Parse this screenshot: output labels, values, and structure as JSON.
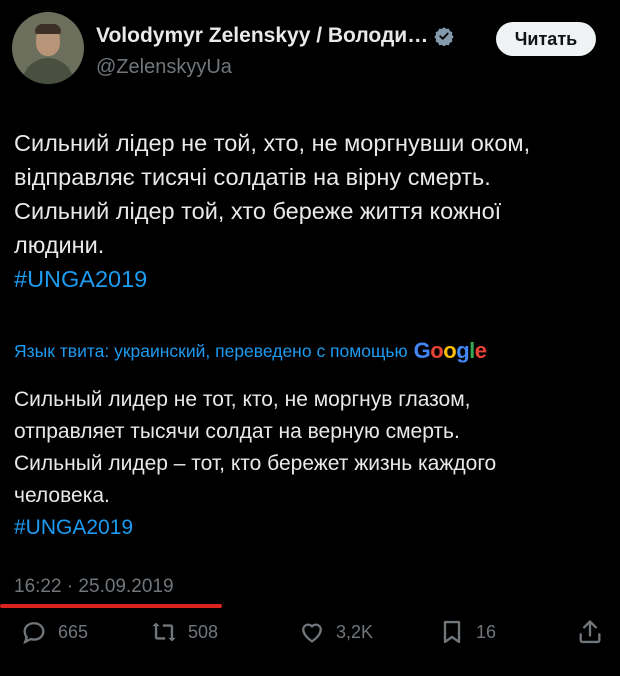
{
  "author": {
    "name": "Volodymyr Zelenskyy / Володи…",
    "handle": "@ZelenskyyUa",
    "follow_label": "Читать"
  },
  "tweet": {
    "lines": [
      "Сильний лідер не той, хто, не моргнувши оком,",
      "відправляє тисячі солдатів на вірну смерть.",
      "Сильний лідер той, хто береже життя кожної",
      "людини."
    ],
    "hashtag": "#UNGA2019"
  },
  "translation": {
    "label": "Язык твита: украинский, переведено с помощью",
    "provider": "Google",
    "lines": [
      "Сильный лидер не тот, кто, не моргнув глазом,",
      "отправляет тысячи солдат на верную смерть.",
      "Сильный лидер – тот, кто бережет жизнь каждого",
      "человека."
    ],
    "hashtag": "#UNGA2019"
  },
  "timestamp": "16:22 · 25.09.2019",
  "actions": {
    "replies": "665",
    "reposts": "508",
    "likes": "3,2K",
    "bookmarks": "16"
  },
  "colors": {
    "accent": "#1d9bf0",
    "background": "#000000",
    "text": "#e7e9ea",
    "muted": "#71767b",
    "highlight_underline": "#d9231f"
  },
  "icons": [
    "verified-badge-icon",
    "reply-icon",
    "repost-icon",
    "like-icon",
    "bookmark-icon",
    "share-icon"
  ]
}
